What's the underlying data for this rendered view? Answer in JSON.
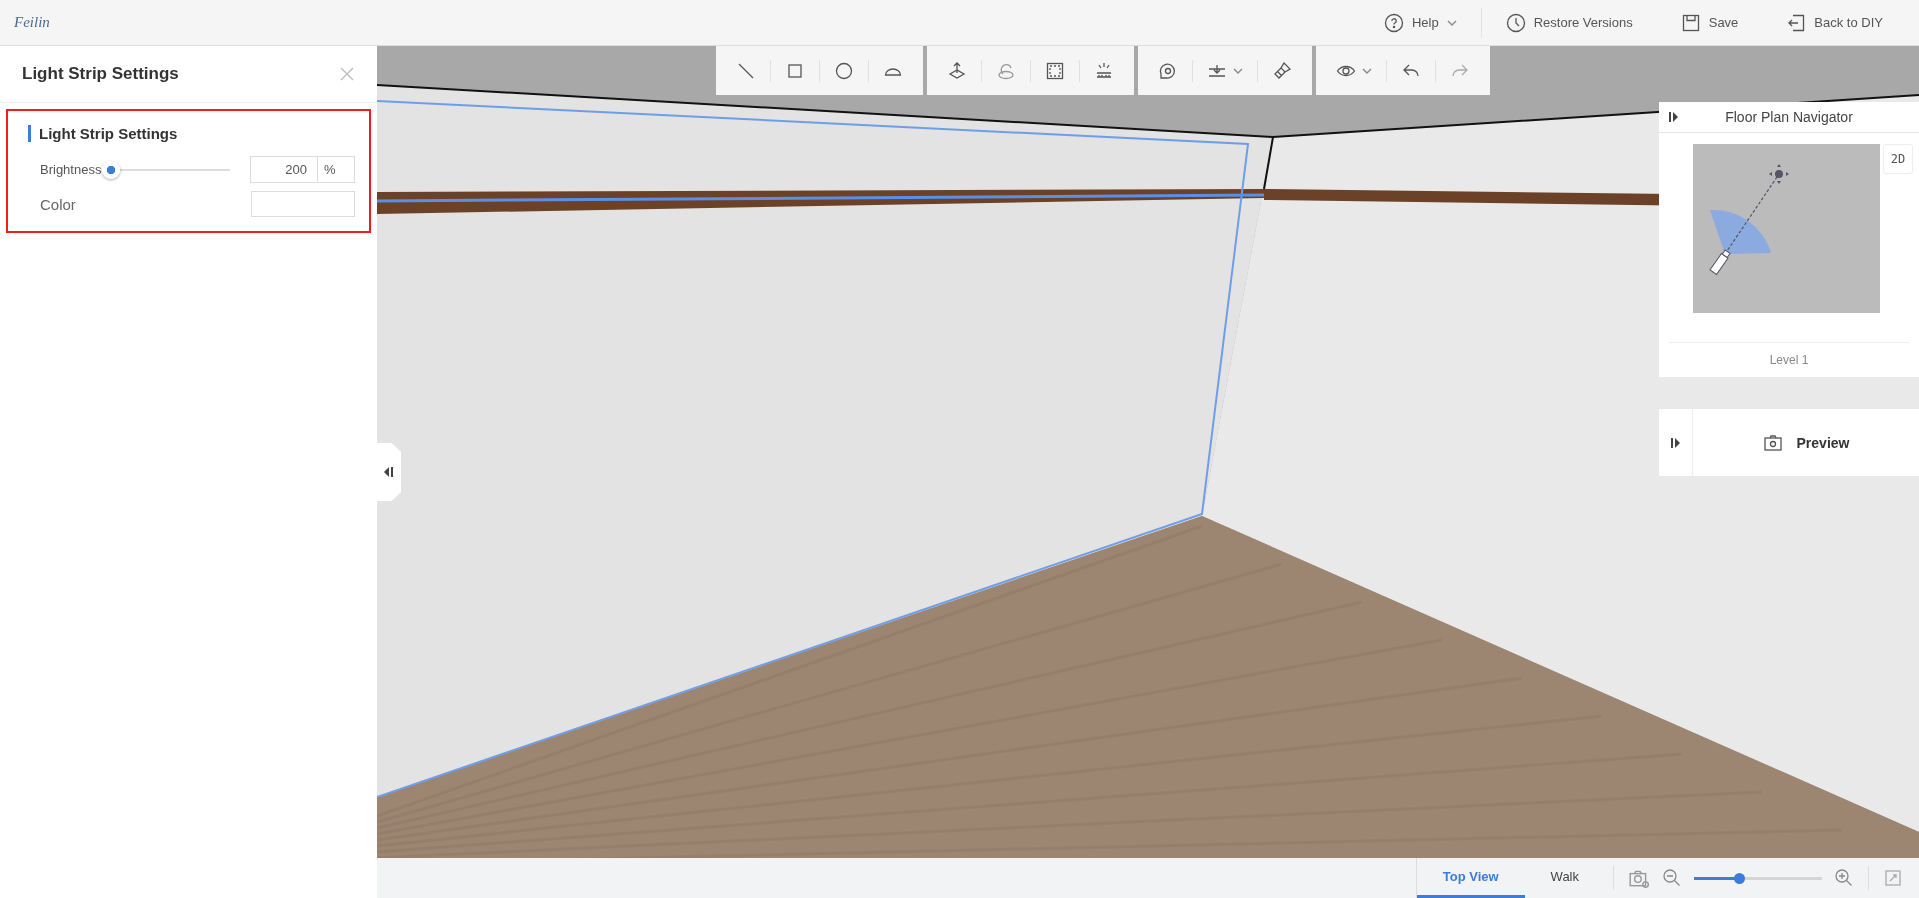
{
  "header": {
    "logo": "Feilin",
    "actions": [
      {
        "kind": "help",
        "label": "Help",
        "dropdown": true
      },
      {
        "kind": "restore",
        "label": "Restore Versions",
        "dropdown": false
      },
      {
        "kind": "save",
        "label": "Save",
        "dropdown": false
      },
      {
        "kind": "back",
        "label": "Back to DIY",
        "dropdown": false
      }
    ]
  },
  "settings_panel": {
    "title": "Light Strip Settings",
    "section_title": "Light Strip Settings",
    "brightness": {
      "label": "Brightness",
      "level": 0,
      "value": "200",
      "unit": "%"
    },
    "color": {
      "label": "Color"
    }
  },
  "navigator": {
    "title": "Floor Plan Navigator",
    "mode": "2D",
    "floor": "Level 1"
  },
  "preview": {
    "label": "Preview"
  },
  "view_tabs": [
    {
      "label": "Top View",
      "selected": true
    },
    {
      "label": "Walk",
      "selected": false
    }
  ],
  "zoom": {
    "level": 0.35
  }
}
